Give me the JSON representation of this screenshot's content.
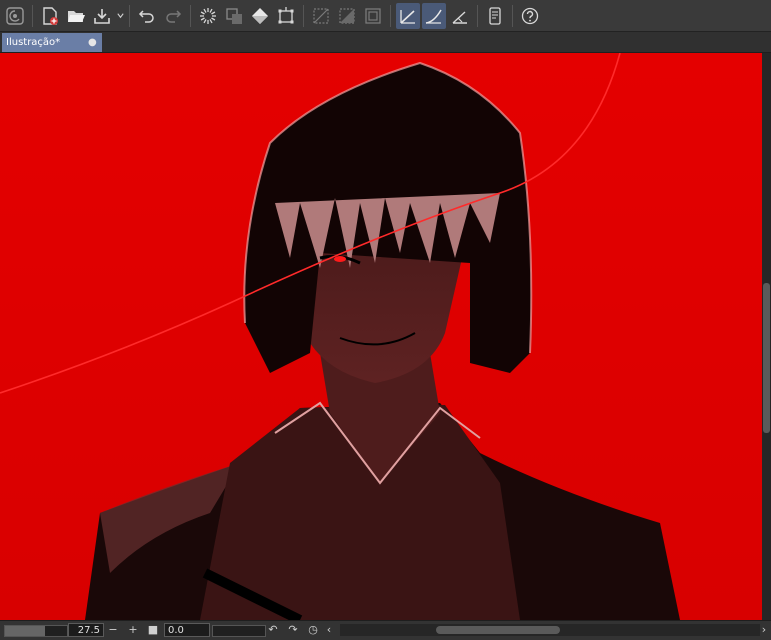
{
  "toolbar": {
    "buttons": [
      {
        "id": "clip-studio-logo",
        "icon": "clip-logo-icon"
      },
      {
        "id": "new",
        "icon": "new-canvas-icon"
      },
      {
        "id": "open",
        "icon": "folder-open-icon"
      },
      {
        "id": "save",
        "icon": "save-icon"
      },
      {
        "id": "undo",
        "icon": "undo-icon"
      },
      {
        "id": "redo",
        "icon": "redo-icon"
      },
      {
        "id": "loading",
        "icon": "spinner-icon"
      },
      {
        "id": "clear",
        "icon": "clear-layer-icon"
      },
      {
        "id": "fill",
        "icon": "fill-bucket-icon"
      },
      {
        "id": "transform",
        "icon": "transform-icon"
      },
      {
        "id": "deselect",
        "icon": "deselect-icon"
      },
      {
        "id": "invert-selection",
        "icon": "invert-selection-icon"
      },
      {
        "id": "show-selection",
        "icon": "selection-border-icon"
      },
      {
        "id": "snap-ruler",
        "icon": "snap-ruler-icon"
      },
      {
        "id": "snap-special-ruler",
        "icon": "snap-special-ruler-icon"
      },
      {
        "id": "snap-grid",
        "icon": "snap-grid-icon"
      },
      {
        "id": "companion",
        "icon": "companion-device-icon"
      },
      {
        "id": "help",
        "icon": "help-icon"
      }
    ]
  },
  "tabs": [
    {
      "label": "Ilustração*",
      "close": "●"
    }
  ],
  "status": {
    "zoom_value": "27.5",
    "zoom_out": "−",
    "zoom_in": "+",
    "fit": "■",
    "rotation_value": "0.0",
    "rotate_left": "↶",
    "rotate_right": "↷",
    "reset_rotation": "◷",
    "scroll_left": "‹",
    "scroll_right": "›",
    "zoom_fraction": 0.65
  },
  "colors": {
    "accent": "#6a7ea6",
    "canvas_bg": "#e00000",
    "active_tool": "#4a5a78"
  }
}
